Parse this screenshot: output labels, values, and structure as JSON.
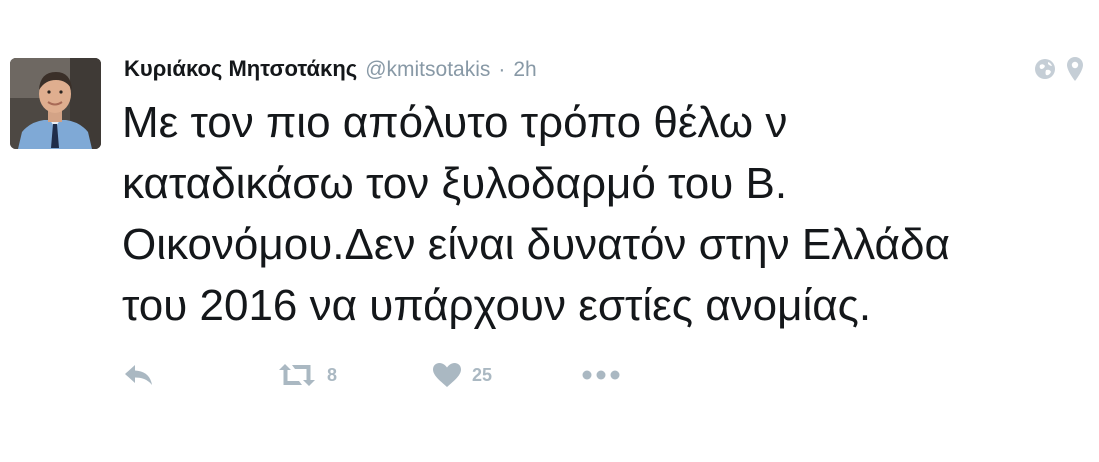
{
  "tweet": {
    "display_name": "Κυριάκος Μητσοτάκης",
    "handle": "@kmitsotakis",
    "separator": "·",
    "time": "2h",
    "text": "Με τον πιο απόλυτο τρόπο θέλω ν\nκαταδικάσω τον ξυλοδαρμό του Β.\nΟικονόμου.Δεν είναι δυνατόν στην Ελλάδα\nτου 2016 να υπάρχουν εστίες ανομίας.",
    "retweet_count": "8",
    "like_count": "25"
  },
  "icons": {
    "reply": "reply-icon",
    "retweet": "retweet-icon",
    "like": "heart-icon",
    "more": "more-icon",
    "globe": "globe-icon",
    "location": "location-pin-icon"
  },
  "colors": {
    "text": "#14171a",
    "secondary": "#8899a6",
    "action": "#aab8c2"
  }
}
